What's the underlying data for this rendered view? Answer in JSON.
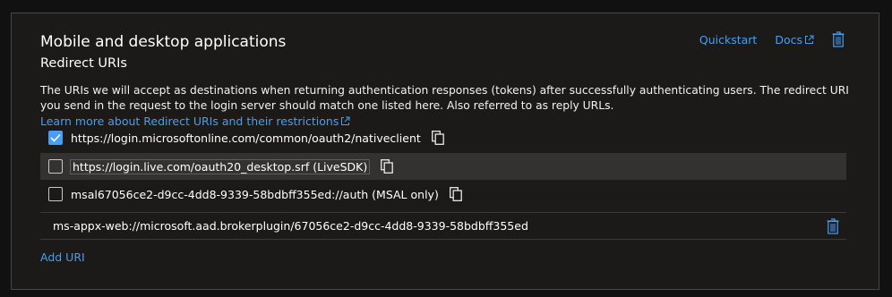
{
  "section": {
    "title": "Mobile and desktop applications",
    "subtitle": "Redirect URIs"
  },
  "actions": {
    "quickstart_label": "Quickstart",
    "docs_label": "Docs"
  },
  "description": {
    "text": "The URIs we will accept as destinations when returning authentication responses (tokens) after successfully authenticating users. The redirect URI you send in the request to the login server should match one listed here. Also referred to as reply URLs.",
    "learn_more_label": "Learn more about Redirect URIs and their restrictions"
  },
  "uris": [
    {
      "label": "https://login.microsoftonline.com/common/oauth2/nativeclient",
      "checked": true
    },
    {
      "label": "https://login.live.com/oauth20_desktop.srf (LiveSDK)",
      "checked": false
    },
    {
      "label": "msal67056ce2-d9cc-4dd8-9339-58bdbff355ed://auth (MSAL only)",
      "checked": false
    }
  ],
  "custom_uri": {
    "value": "ms-appx-web://microsoft.aad.brokerplugin/67056ce2-d9cc-4dd8-9339-58bdbff355ed"
  },
  "add_uri_label": "Add URI",
  "colors": {
    "accent": "#479ef5",
    "background": "#1b1a19",
    "row_highlight": "#333231"
  },
  "icons": {
    "external_link": "external-link-icon",
    "trash": "trash-icon",
    "copy": "copy-icon",
    "check": "checkmark-icon"
  }
}
